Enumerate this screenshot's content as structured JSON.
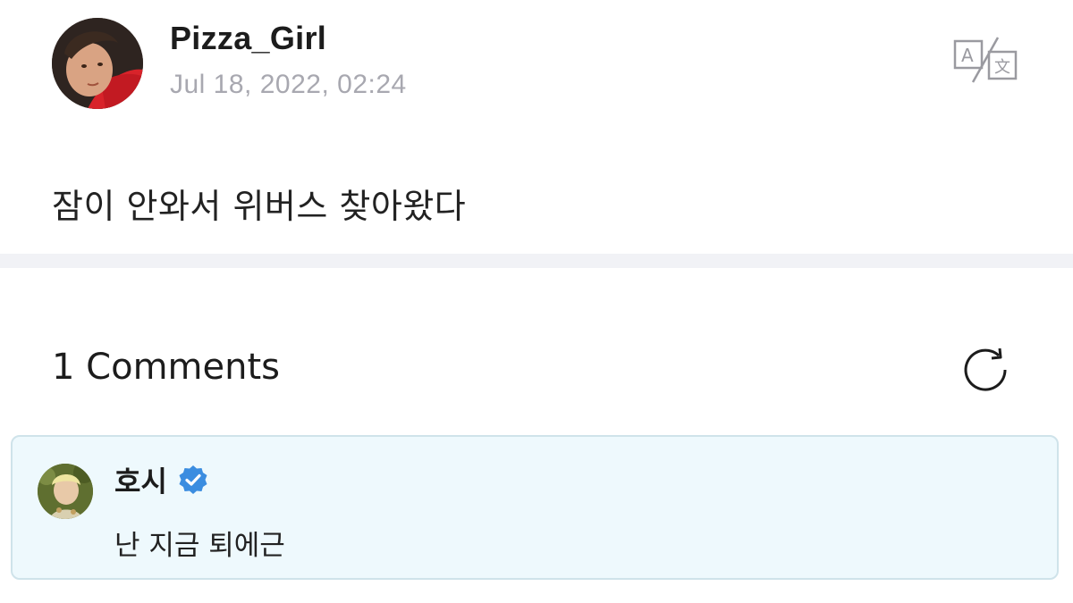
{
  "post": {
    "author": "Pizza_Girl",
    "timestamp": "Jul 18, 2022, 02:24",
    "body": "잠이 안와서 위버스 찾아왔다",
    "translate_icon": "translate-icon"
  },
  "comments": {
    "count_label": "1 Comments",
    "refresh_icon": "refresh-icon",
    "items": [
      {
        "author": "호시",
        "verified": true,
        "text": "난 지금 퇴에근"
      }
    ]
  },
  "colors": {
    "accent_verified": "#3b8de0",
    "comment_card_bg": "#eef9fd",
    "comment_card_border": "#cfe3ea",
    "timestamp": "#a8a8b0",
    "divider": "#f1f2f6"
  }
}
